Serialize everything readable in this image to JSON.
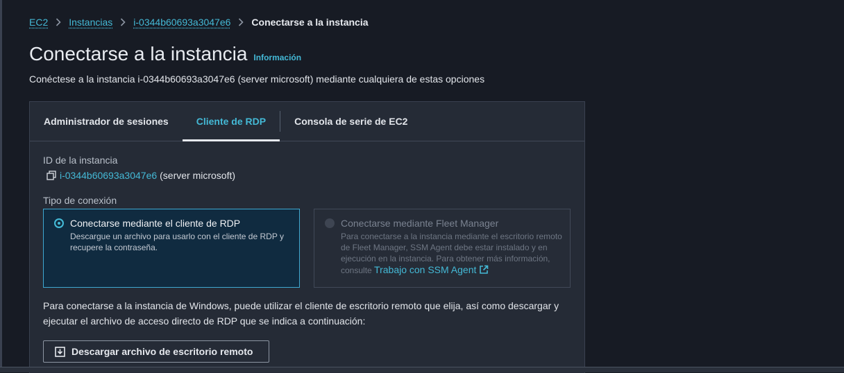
{
  "breadcrumb": {
    "items": [
      "EC2",
      "Instancias",
      "i-0344b60693a3047e6"
    ],
    "current": "Conectarse a la instancia"
  },
  "header": {
    "title": "Conectarse a la instancia",
    "info_label": "Información",
    "subtitle": "Conéctese a la instancia i-0344b60693a3047e6 (server microsoft) mediante cualquiera de estas opciones"
  },
  "tabs": [
    {
      "label": "Administrador de sesiones",
      "active": false
    },
    {
      "label": "Cliente de RDP",
      "active": true
    },
    {
      "label": "Consola de serie de EC2",
      "active": false
    }
  ],
  "instance": {
    "label": "ID de la instancia",
    "id": "i-0344b60693a3047e6",
    "name": "(server microsoft)"
  },
  "connection": {
    "label": "Tipo de conexión",
    "options": [
      {
        "title": "Conectarse mediante el cliente de RDP",
        "description": "Descargue un archivo para usarlo con el cliente de RDP y recupere la contraseña.",
        "selected": true
      },
      {
        "title": "Conectarse mediante Fleet Manager",
        "description": "Para conectarse a la instancia mediante el escritorio remoto de Fleet Manager, SSM Agent debe estar instalado y en ejecución en la instancia. Para obtener más información, consulte",
        "link": "Trabajo con SSM Agent",
        "selected": false
      }
    ]
  },
  "body_text": "Para conectarse a la instancia de Windows, puede utilizar el cliente de escritorio remoto que elija, así como descargar y ejecutar el archivo de acceso directo de RDP que se indica a continuación:",
  "download_button": "Descargar archivo de escritorio remoto",
  "colors": {
    "background": "#171b24",
    "panel": "#252b36",
    "accent": "#44b9d6",
    "selected_tile": "#102b40"
  }
}
